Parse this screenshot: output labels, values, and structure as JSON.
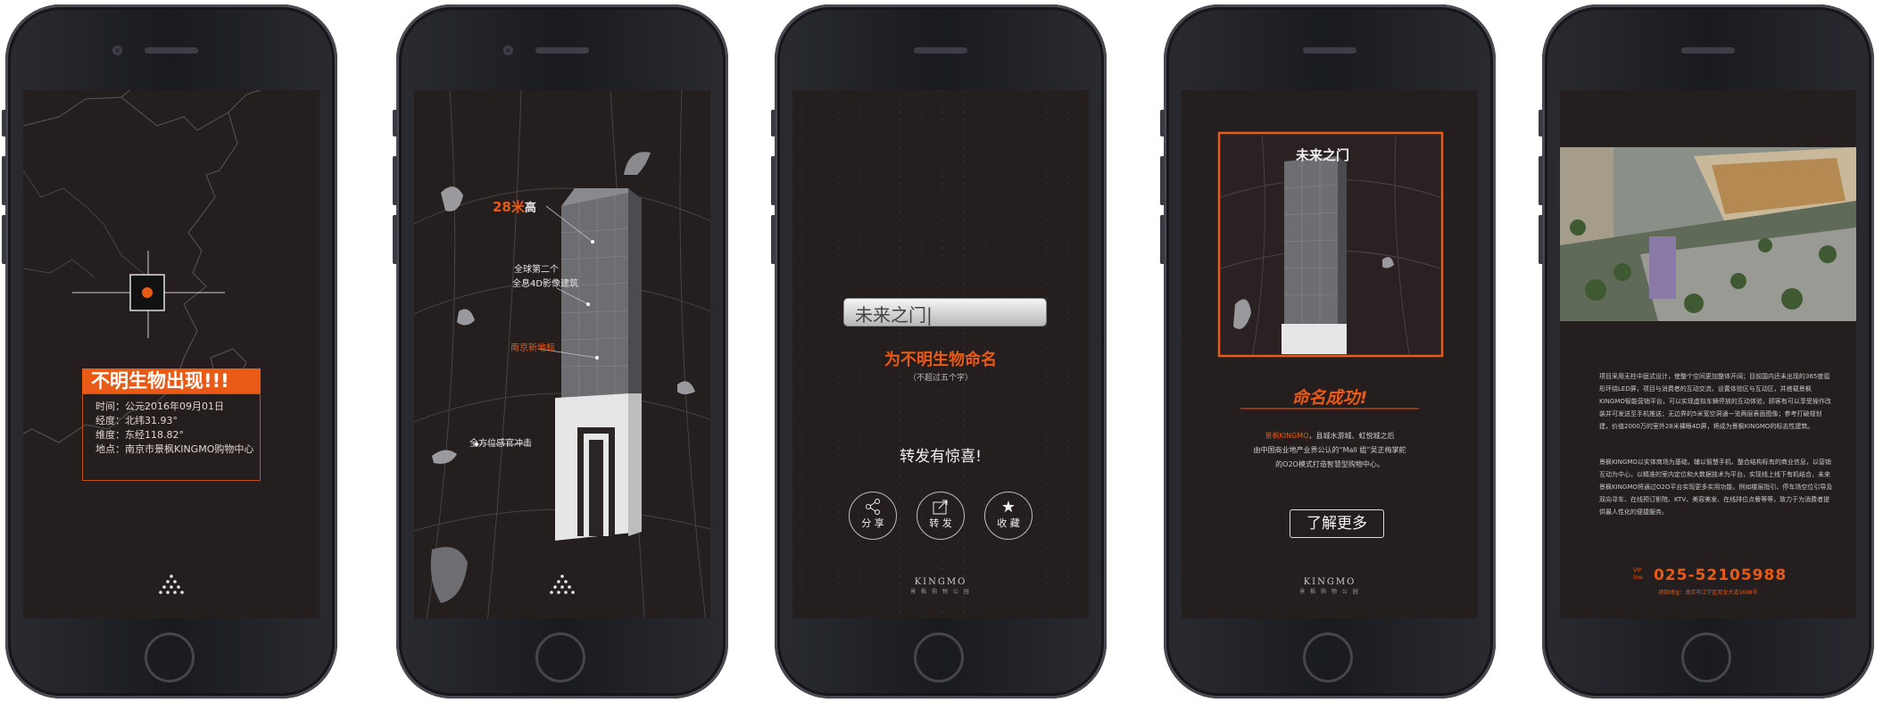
{
  "screen1": {
    "alert_title": "不明生物出现!!!",
    "time": "时间：公元2016年09月01日",
    "latitude": "经度：北纬31.93°",
    "longitude": "维度：东经118.82°",
    "location": "地点：南京市景枫KINGMO购物中心"
  },
  "screen2": {
    "height_num": "28米",
    "height_unit": "高",
    "label_rank_1": "全球第二个",
    "label_rank_2": "全息4D影像建筑",
    "label_landmark": "南京新地标",
    "label_impact": "全方位感官冲击"
  },
  "screen3": {
    "name_input_value": "未来之门|",
    "title": "为不明生物命名",
    "subtitle": "（不超过五个字）",
    "forward_text": "转发有惊喜!",
    "actions": [
      {
        "label": "分 享",
        "icon": "share-icon"
      },
      {
        "label": "转 发",
        "icon": "forward-icon"
      },
      {
        "label": "收 藏",
        "icon": "star-icon"
      }
    ],
    "logo_main": "KINGMO",
    "logo_sub": "景 枫 购 物 公 园"
  },
  "screen4": {
    "tower_sign": "未来之门",
    "success_title": "命名成功!",
    "desc_highlight": "景枫KINGMO",
    "desc_line1_rest": "，县城水游城、虹悦城之后",
    "desc_line2": "由中国商业地产业界公认的“Mall 姐”吴正梅掌舵",
    "desc_line3": "的O2O模式打造智慧型购物中心。",
    "more_button": "了解更多",
    "logo_main": "KINGMO",
    "logo_sub": "景 枫 购 物 公 园"
  },
  "screen5": {
    "para1": "项目采用无柱中庭式设计，使整个空间更加整体开阔；目前国内还未出现的365度弧形环绕LED屏，项目与消费者的互动交流，设置体验区与互动区，并搭载景枫KINGMO智能营销平台，可以实现虚拟车辆停放的互动体验，顾客有可以享受操作改装并可发送至手机推送；无边界的5米宽空洞通一览两层表面图像；参考打破规划建，价值2000万的室外28米裸眼4D屏，将成为景枫KINGMO的标志性建筑。",
    "para2": "景枫KINGMO以实体商场为基础，辅以智慧手机、整合结构标有的商业信息，以营销互动为中心，以精准的室内定位和大数据技术为平台，实现线上线下有机结合，未来景枫KINGMO将通过O2O平台实现更多实用功能，例如楼层指引、停车场空位引导及双向寻车、在线预订影院、KTV、美容美发、在线排位点餐等等，致力于为消费者提供最人性化的便捷服务。",
    "hotline_label": "VIP line",
    "hotline": "025-52105988",
    "address": "项目地址：南京市江宁区双龙大道1698号"
  },
  "colors": {
    "accent": "#e85a16",
    "screen_bg": "#241e1e"
  }
}
